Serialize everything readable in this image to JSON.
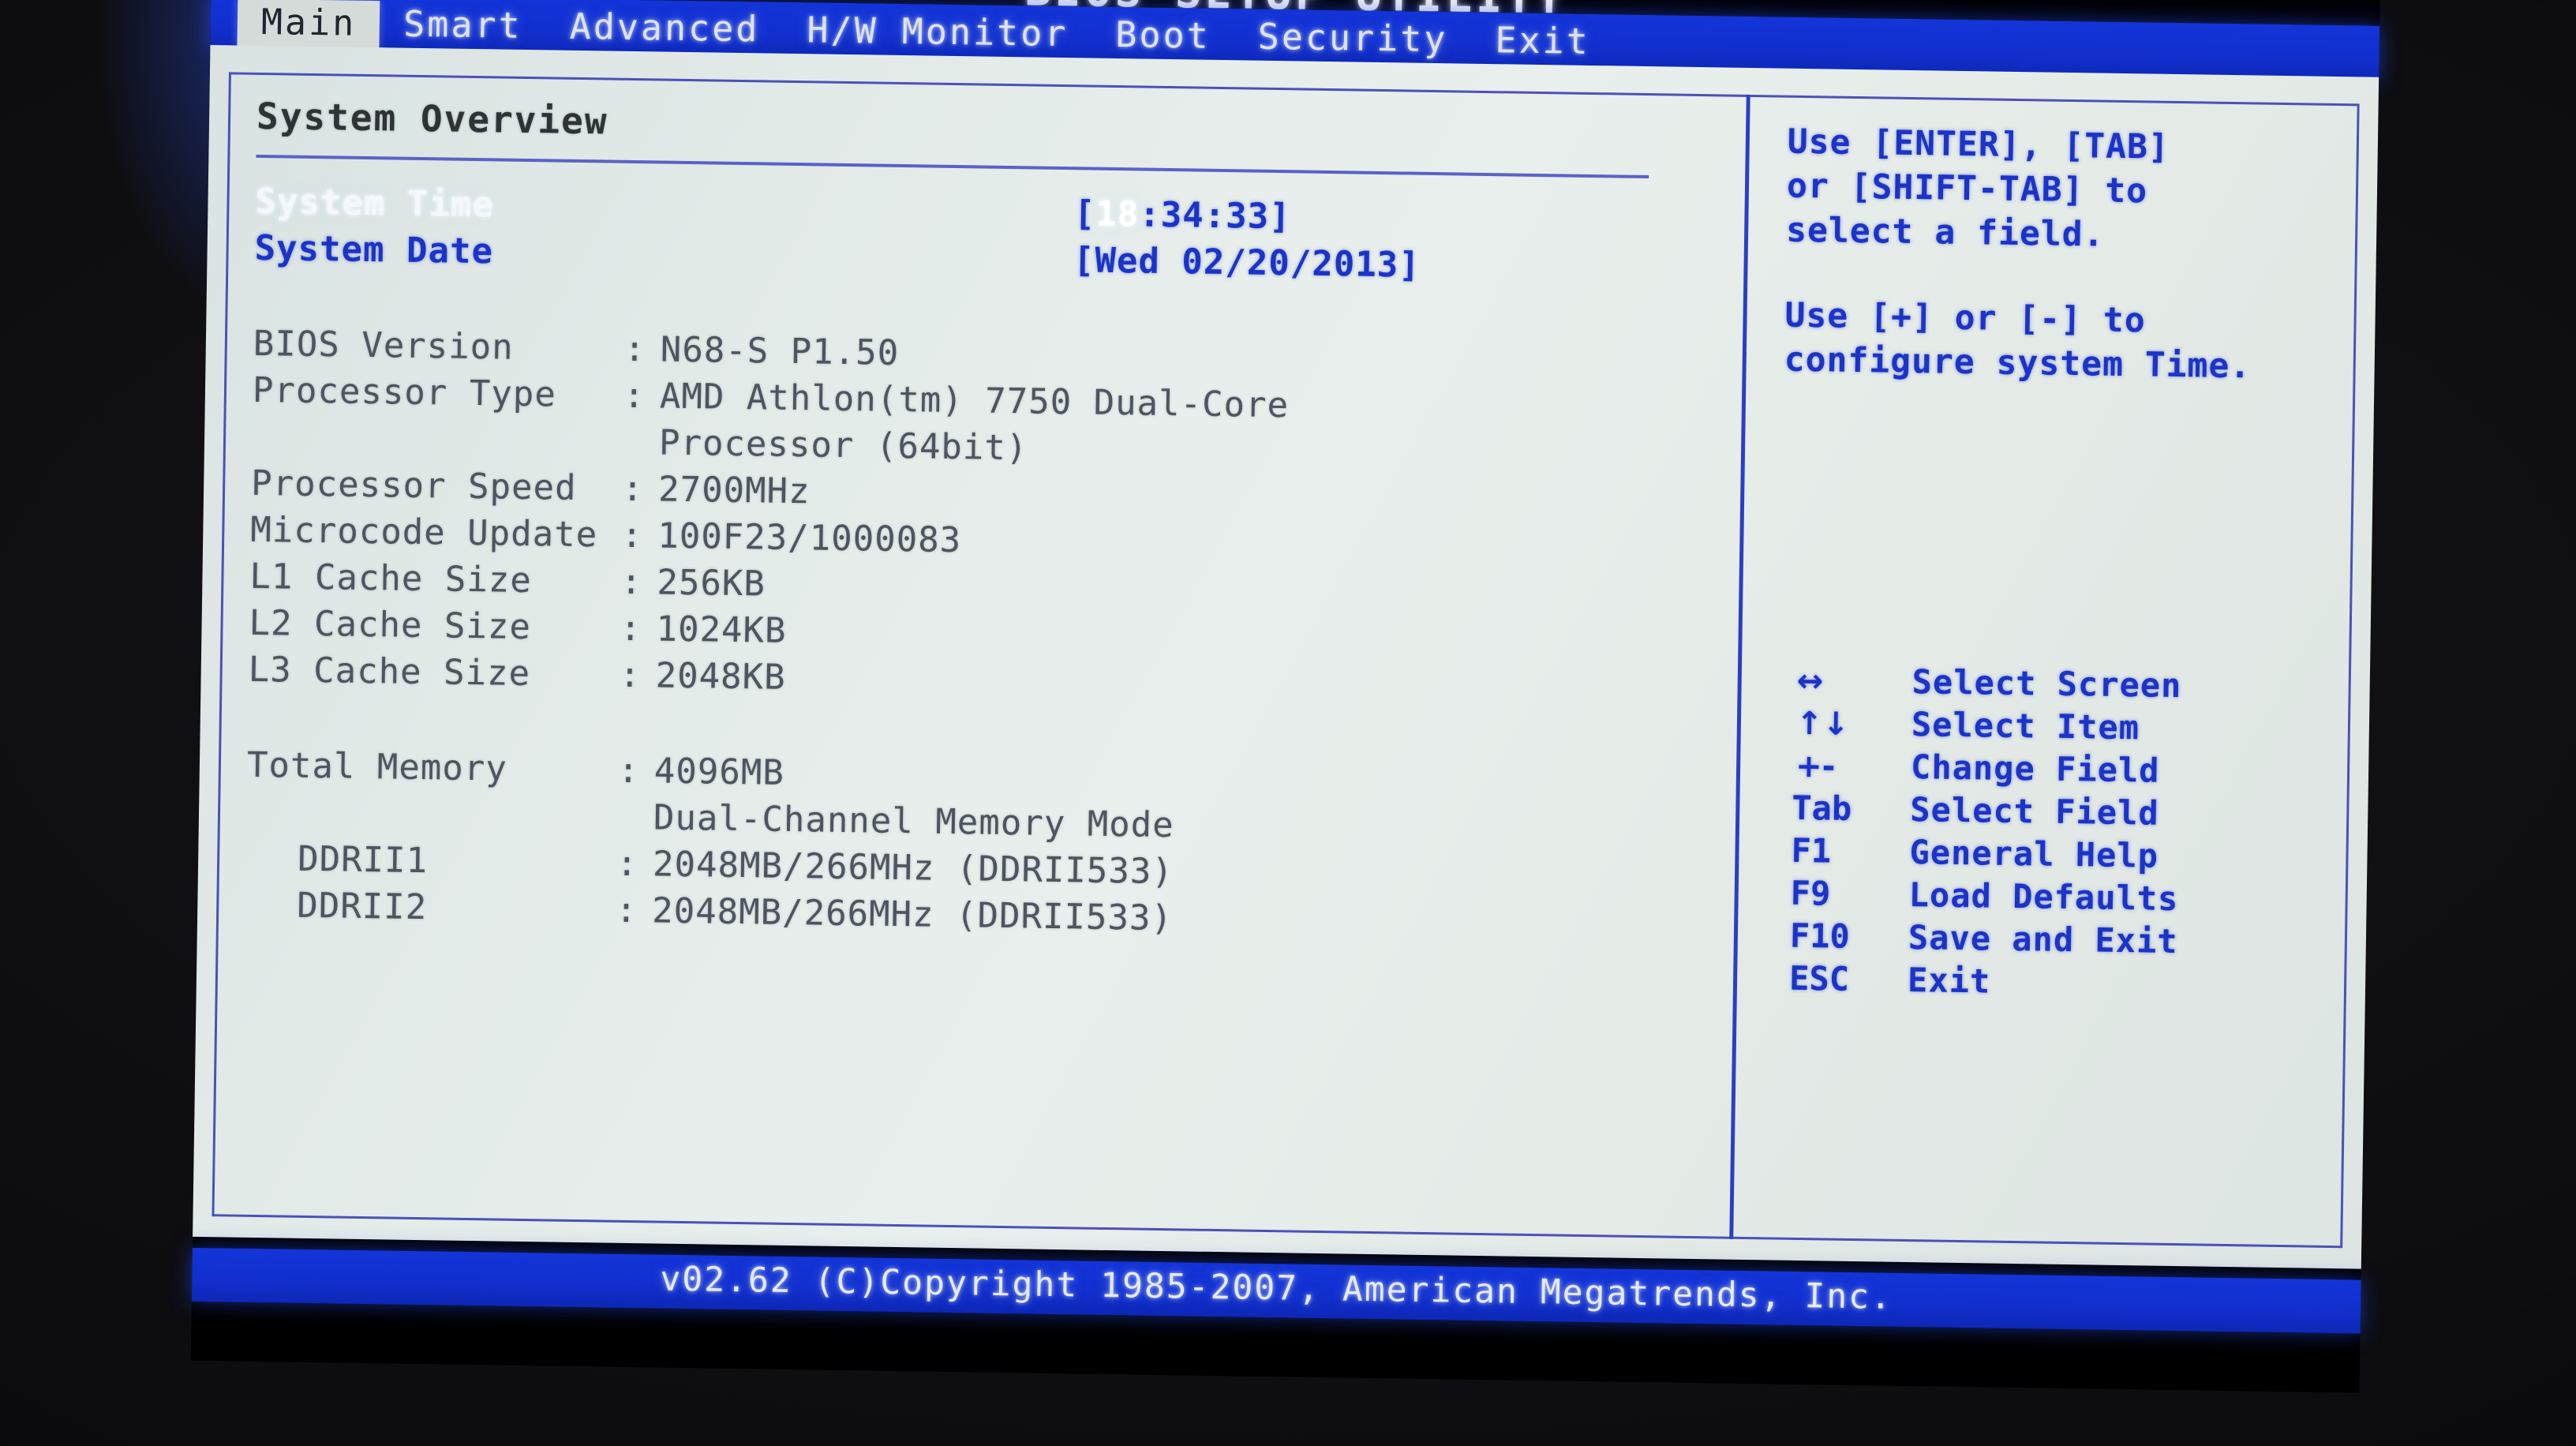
{
  "window": {
    "title": "BIOS SETUP UTILITY"
  },
  "menu": {
    "items": [
      {
        "label": "Main",
        "selected": true
      },
      {
        "label": "Smart",
        "selected": false
      },
      {
        "label": "Advanced",
        "selected": false
      },
      {
        "label": "H/W Monitor",
        "selected": false
      },
      {
        "label": "Boot",
        "selected": false
      },
      {
        "label": "Security",
        "selected": false
      },
      {
        "label": "Exit",
        "selected": false
      }
    ]
  },
  "main": {
    "section_title": "System Overview",
    "system_time": {
      "label": "System Time",
      "value_open": "[",
      "value_hours": "18",
      "value_rest": ":34:33]"
    },
    "system_date": {
      "label": "System Date",
      "value": "[Wed 02/20/2013]"
    },
    "info_rows": [
      {
        "label": "BIOS Version",
        "sep": ":",
        "value": "N68-S P1.50"
      },
      {
        "label": "Processor Type",
        "sep": ":",
        "value": "AMD Athlon(tm) 7750 Dual-Core"
      },
      {
        "label": "",
        "sep": "",
        "value": "Processor (64bit)"
      },
      {
        "label": "Processor Speed",
        "sep": ":",
        "value": "2700MHz"
      },
      {
        "label": "Microcode Update",
        "sep": ":",
        "value": "100F23/1000083"
      },
      {
        "label": "L1 Cache Size",
        "sep": ":",
        "value": "256KB"
      },
      {
        "label": "L2 Cache Size",
        "sep": ":",
        "value": "1024KB"
      },
      {
        "label": "L3 Cache Size",
        "sep": ":",
        "value": "2048KB"
      }
    ],
    "memory_rows": [
      {
        "label": "Total Memory",
        "sep": ":",
        "value": "4096MB",
        "indent": false
      },
      {
        "label": "",
        "sep": "",
        "value": "Dual-Channel Memory Mode",
        "indent": false
      },
      {
        "label": "DDRII1",
        "sep": ":",
        "value": "2048MB/266MHz  (DDRII533)",
        "indent": true
      },
      {
        "label": "DDRII2",
        "sep": ":",
        "value": "2048MB/266MHz  (DDRII533)",
        "indent": true
      }
    ]
  },
  "help": {
    "paragraph_1": [
      "Use [ENTER], [TAB]",
      "or [SHIFT-TAB] to",
      "select a field."
    ],
    "paragraph_2": [
      "Use [+] or [-] to",
      "configure system Time."
    ]
  },
  "keys": {
    "legend": [
      {
        "key": "↔",
        "desc": "Select Screen",
        "icon": "left-right-arrow-icon"
      },
      {
        "key": "↑↓",
        "desc": "Select Item",
        "icon": "up-down-arrow-icon"
      },
      {
        "key": "+-",
        "desc": "Change Field",
        "icon": "plus-minus-icon"
      },
      {
        "key": "Tab",
        "desc": "Select Field",
        "icon": ""
      },
      {
        "key": "F1",
        "desc": "General Help",
        "icon": ""
      },
      {
        "key": "F9",
        "desc": "Load Defaults",
        "icon": ""
      },
      {
        "key": "F10",
        "desc": "Save and Exit",
        "icon": ""
      },
      {
        "key": "ESC",
        "desc": "Exit",
        "icon": ""
      }
    ]
  },
  "footer": {
    "text": "v02.62 (C)Copyright 1985-2007, American Megatrends, Inc."
  },
  "colors": {
    "menu_blue": "#1230cf",
    "panel_bg": "#e2eae8",
    "text_blue": "#1c34c6",
    "text_gray": "#4e5560",
    "highlight_white": "#ffffff",
    "border_blue": "#4a52b8"
  }
}
